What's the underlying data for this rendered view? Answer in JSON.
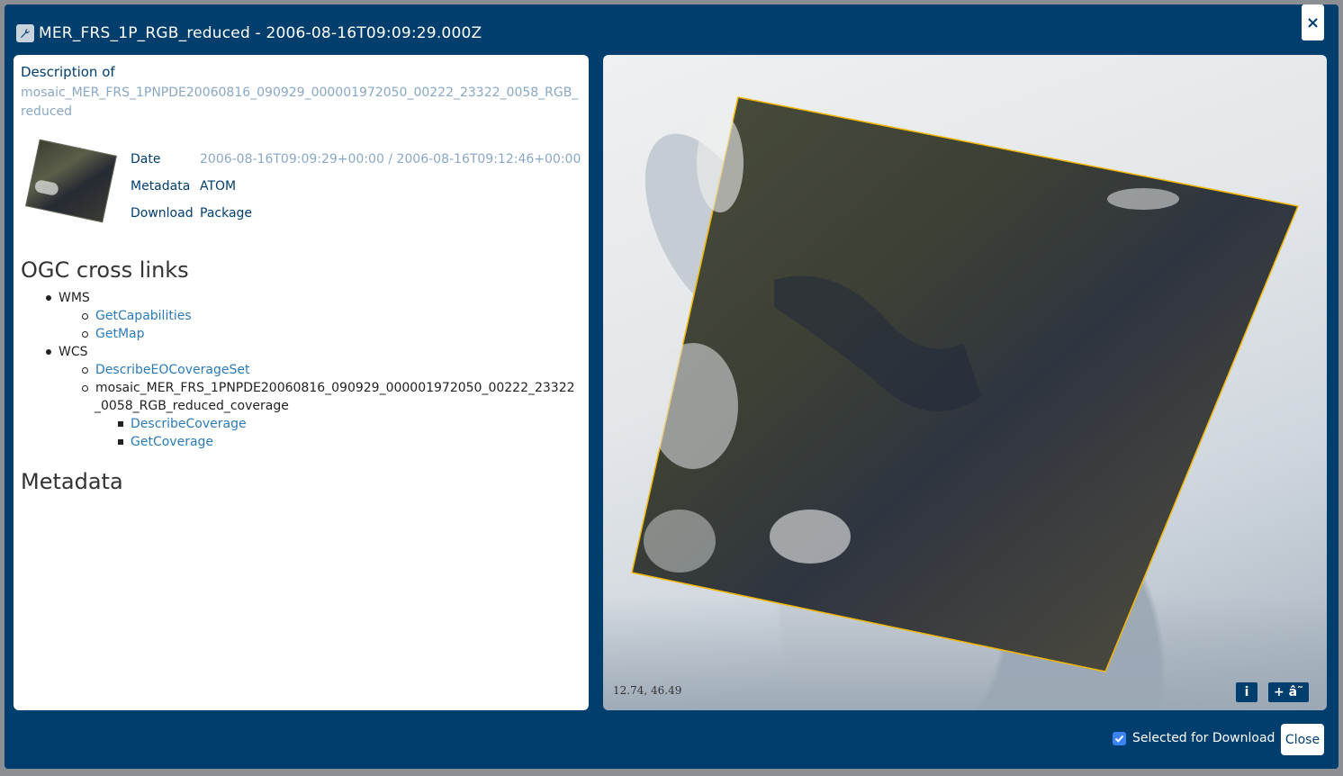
{
  "window": {
    "title": "MER_FRS_1P_RGB_reduced - 2006-08-16T09:09:29.000Z",
    "close_glyph": "×",
    "title_icon": "wrench-icon"
  },
  "details": {
    "description_heading": "Description of",
    "product_id": "mosaic_MER_FRS_1PNPDE20060816_090929_000001972050_00222_23322_0058_RGB_reduced",
    "date_label": "Date",
    "date_value": "2006-08-16T09:09:29+00:00 / 2006-08-16T09:12:46+00:00",
    "metadata_label": "Metadata",
    "metadata_value": "ATOM",
    "download_label": "Download",
    "download_value": "Package"
  },
  "ogc": {
    "heading": "OGC cross links",
    "wms_label": "WMS",
    "wms_links": [
      "GetCapabilities",
      "GetMap"
    ],
    "wcs_label": "WCS",
    "wcs_describe": "DescribeEOCoverageSet",
    "coverage_line1": "mosaic_MER_FRS_1PNPDE20060816_090929_000001972050_00222_23322",
    "coverage_line2": "_0058_RGB_reduced_coverage",
    "coverage_links": [
      "DescribeCoverage",
      "GetCoverage"
    ]
  },
  "metadata_section": {
    "heading": "Metadata"
  },
  "map": {
    "coordinates": "12.74, 46.49",
    "info_label": "i",
    "zoom_label": "+ â˜"
  },
  "footer": {
    "selected_label": "Selected for Download",
    "selected": true,
    "close_label": "Close"
  },
  "colors": {
    "primary": "#003e6e",
    "link": "#2a7ab8",
    "muted": "#8aa7c4",
    "footprint": "#f2b700"
  }
}
